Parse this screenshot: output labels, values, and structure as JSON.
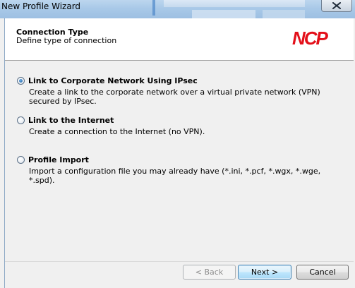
{
  "window": {
    "title": "New Profile Wizard"
  },
  "header": {
    "title": "Connection Type",
    "subtitle": "Define type of connection",
    "logo_text": "NCP",
    "logo_color": "#e3101a"
  },
  "options": [
    {
      "label": "Link to Corporate Network Using IPsec",
      "description": "Create a link to the corporate network over a virtual private network (VPN) secured by IPsec.",
      "selected": true
    },
    {
      "label": "Link to the Internet",
      "description": "Create a connection to the Internet (no VPN).",
      "selected": false
    },
    {
      "label": "Profile Import",
      "description": "Import a configuration file you may already have (*.ini, *.pcf, *.wgx, *.wge, *.spd).",
      "selected": false
    }
  ],
  "buttons": {
    "back": "< Back",
    "next": "Next >",
    "cancel": "Cancel"
  }
}
